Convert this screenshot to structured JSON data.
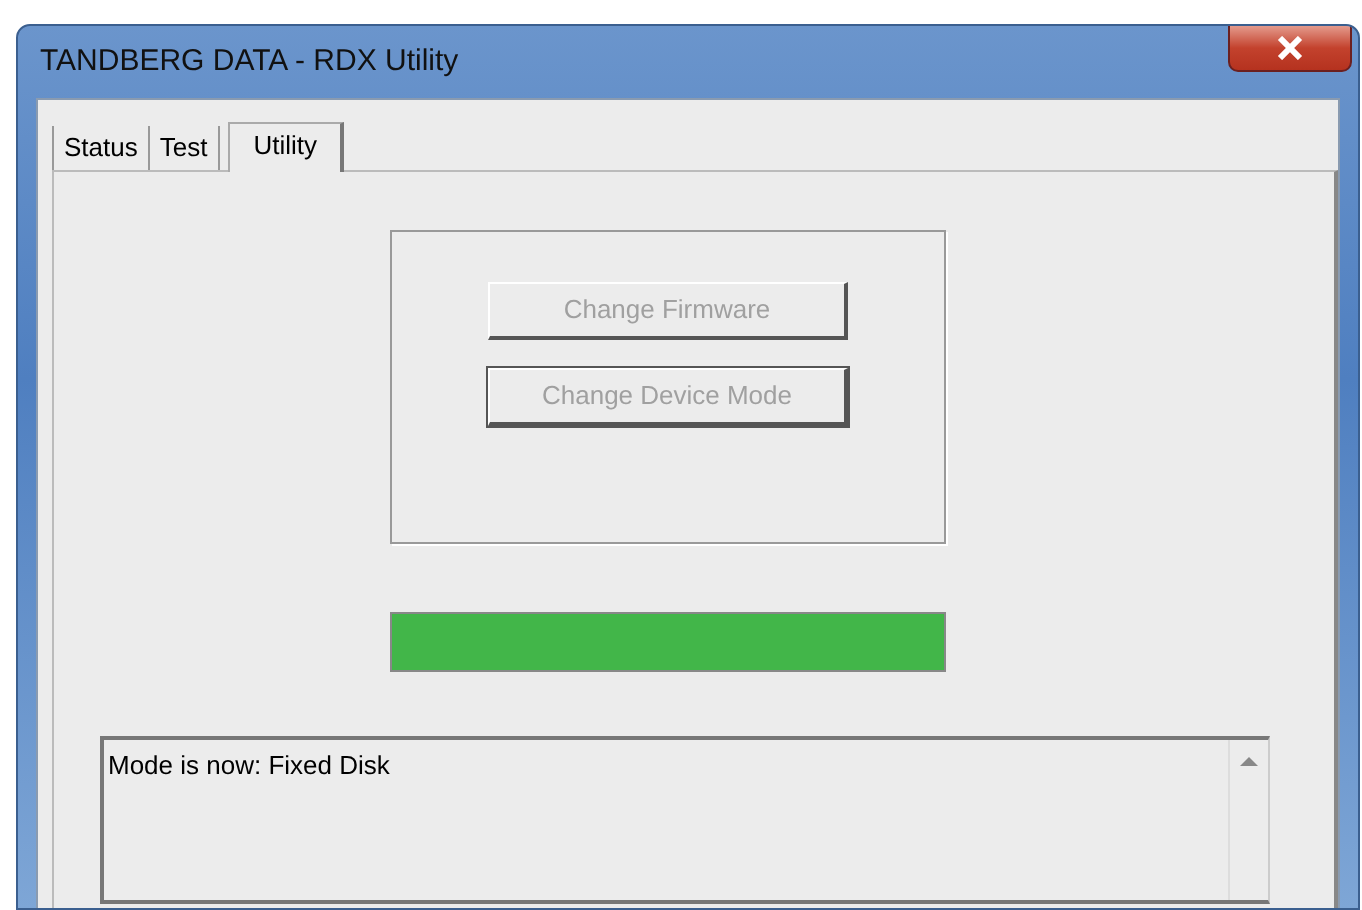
{
  "window": {
    "title": "TANDBERG DATA - RDX Utility"
  },
  "tabs": [
    {
      "label": "Status",
      "selected": false
    },
    {
      "label": "Test",
      "selected": false
    },
    {
      "label": "Utility",
      "selected": true
    }
  ],
  "buttons": [
    {
      "label": "Change Firmware",
      "disabled": true
    },
    {
      "label": "Change Device Mode",
      "disabled": true
    }
  ],
  "progress": {
    "level": 1
  },
  "log": {
    "lines": [
      "Mode is now: Fixed Disk"
    ]
  }
}
